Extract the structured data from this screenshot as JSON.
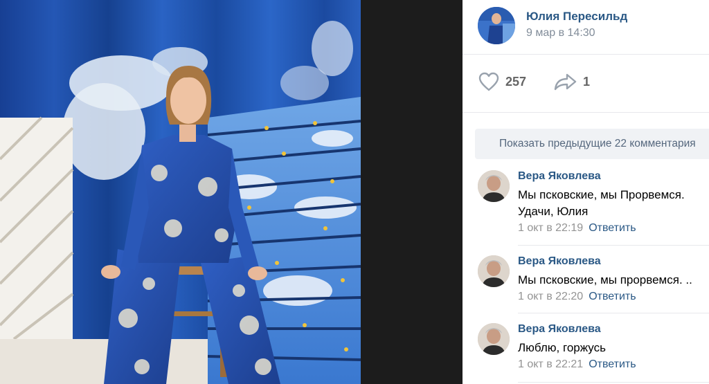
{
  "post": {
    "author_name": "Юлия Пересильд",
    "date": "9 мар в 14:30",
    "likes": "257",
    "shares": "1"
  },
  "comments_panel": {
    "show_previous": "Показать предыдущие 22 комментария"
  },
  "comments": [
    {
      "author": "Вера Яковлева",
      "text_line1": "Мы псковские, мы Прорвемся.",
      "text_line2": "Удачи, Юлия",
      "date": "1 окт в 22:19",
      "reply": "Ответить"
    },
    {
      "author": "Вера Яковлева",
      "text_line1": "Мы псковские, мы прорвемся. ..",
      "date": "1 окт в 22:20",
      "reply": "Ответить"
    },
    {
      "author": "Вера Яковлева",
      "text_line1": "Люблю, горжусь",
      "date": "1 окт в 22:21",
      "reply": "Ответить"
    }
  ],
  "icons": {
    "like": "heart-icon",
    "share": "share-arrow-icon"
  },
  "colors": {
    "link": "#2a5885",
    "meta": "#939393",
    "viewer_bg": "#1c1c1c",
    "photo_blue": "#2a62c0"
  }
}
